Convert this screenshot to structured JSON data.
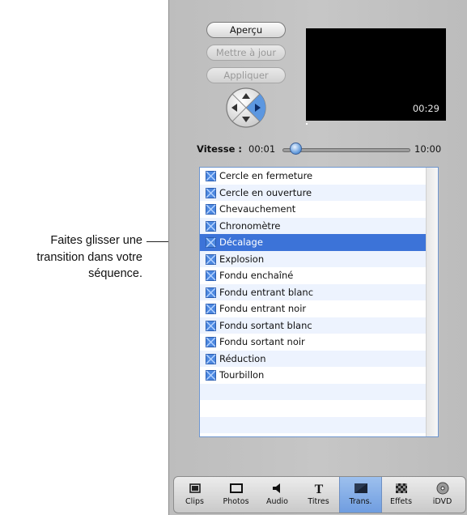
{
  "callout": {
    "lines": [
      "Faites glisser une",
      "transition dans votre",
      "séquence."
    ]
  },
  "controls": {
    "preview_label": "Aperçu",
    "update_label": "Mettre à jour",
    "apply_label": "Appliquer"
  },
  "preview": {
    "timecode": "00:29"
  },
  "speed": {
    "label": "Vitesse :",
    "start": "00:01",
    "end": "10:00"
  },
  "transitions": [
    {
      "label": "Cercle en fermeture"
    },
    {
      "label": "Cercle en ouverture"
    },
    {
      "label": "Chevauchement"
    },
    {
      "label": "Chronomètre"
    },
    {
      "label": "Décalage",
      "selected": true
    },
    {
      "label": "Explosion"
    },
    {
      "label": "Fondu enchaîné"
    },
    {
      "label": "Fondu entrant blanc"
    },
    {
      "label": "Fondu entrant noir"
    },
    {
      "label": "Fondu sortant blanc"
    },
    {
      "label": "Fondu sortant noir"
    },
    {
      "label": "Réduction"
    },
    {
      "label": "Tourbillon"
    }
  ],
  "tabs": [
    {
      "label": "Clips",
      "icon": "clips-icon"
    },
    {
      "label": "Photos",
      "icon": "photos-icon"
    },
    {
      "label": "Audio",
      "icon": "audio-icon"
    },
    {
      "label": "Titres",
      "icon": "titles-icon"
    },
    {
      "label": "Trans.",
      "icon": "transitions-icon",
      "active": true
    },
    {
      "label": "Effets",
      "icon": "effects-icon"
    },
    {
      "label": "iDVD",
      "icon": "idvd-icon"
    }
  ],
  "colors": {
    "selection": "#3c73d8",
    "accent": "#6f9de0"
  }
}
